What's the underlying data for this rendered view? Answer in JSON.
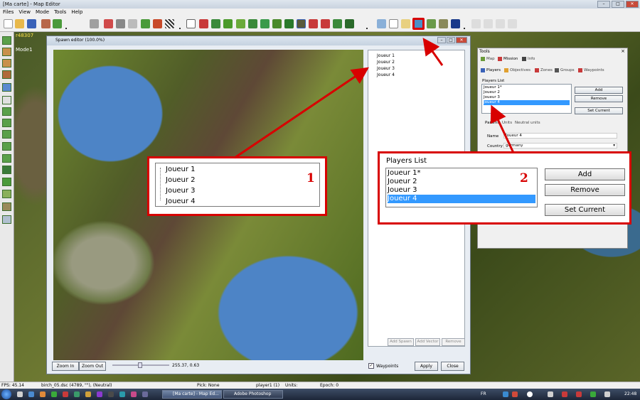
{
  "app": {
    "title": "[Ma carte] - Map Editor"
  },
  "menu": [
    "Files",
    "View",
    "Mode",
    "Tools",
    "Help"
  ],
  "overlay": {
    "coords": "r48307",
    "mode": "Mode1"
  },
  "spawn_editor": {
    "title": "Spawn editor (100.0%)",
    "players": [
      "Joueur 1",
      "Joueur 2",
      "Joueur 3",
      "Joueur 4"
    ],
    "buttons": {
      "add_spawn": "Add Spawn",
      "add_vector": "Add Vector",
      "remove": "Remove",
      "zoom_in": "Zoom In",
      "zoom_out": "Zoom Out",
      "apply": "Apply",
      "close": "Close"
    },
    "position": "255.37, 0.63",
    "waypoints_label": "Waypoints",
    "waypoints_checked": true
  },
  "tools_panel": {
    "title": "Tools",
    "tabs_top": [
      "Map",
      "Mission",
      "Info"
    ],
    "tabs_sub": [
      "Players",
      "Objectives",
      "Zones",
      "Groups",
      "Waypoints"
    ],
    "players_list_label": "Players List",
    "players": [
      "Joueur 1*",
      "Joueur 2",
      "Joueur 3",
      "Joueur 4"
    ],
    "selected_index": 3,
    "buttons": {
      "add": "Add",
      "remove": "Remove",
      "set_current": "Set Current"
    },
    "params_tabs": [
      "Params",
      "Units",
      "Neutral units"
    ],
    "name_label": "Name",
    "name_value": "Joueur 4",
    "country_label": "Country",
    "country_value": "germany"
  },
  "callout1": {
    "number": "1",
    "players": [
      "Joueur 1",
      "Joueur 2",
      "Joueur 3",
      "Joueur 4"
    ]
  },
  "callout2": {
    "number": "2",
    "label": "Players List",
    "players": [
      "Joueur 1*",
      "Joueur 2",
      "Joueur 3",
      "Joueur 4"
    ],
    "buttons": {
      "add": "Add",
      "remove": "Remove",
      "set_current": "Set Current"
    }
  },
  "status_bar": {
    "fps": "FPS: 45.14",
    "file": "birch_05.dsc (4789, \"\"), (Neutral)",
    "pick": "Pick: None",
    "player": "player1 (1)",
    "units": "Units:",
    "epoch": "Epoch: 0"
  },
  "taskbar": {
    "tasks": [
      "[Ma carte] - Map Ed...",
      "Adobe Photoshop"
    ],
    "lang": "FR",
    "time": "22:48"
  },
  "colors": {
    "highlight_red": "#d80000",
    "selection_blue": "#3399ff",
    "coord_yellow": "#ffe44a"
  }
}
